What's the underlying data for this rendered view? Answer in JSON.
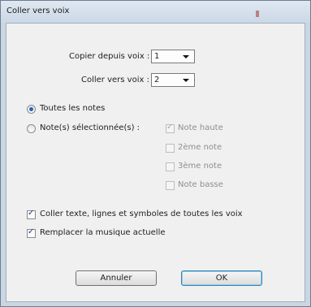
{
  "window": {
    "title": "Coller vers voix"
  },
  "copy_from": {
    "label": "Copier depuis voix :",
    "value": "1"
  },
  "paste_to": {
    "label": "Coller vers voix :",
    "value": "2"
  },
  "scope": {
    "all_notes_label": "Toutes les notes",
    "all_notes_selected": true,
    "selected_notes_label": "Note(s) sélectionnée(s) :",
    "selected_notes_selected": false
  },
  "note_options": [
    {
      "label": "Note haute",
      "checked": true
    },
    {
      "label": "2ème note",
      "checked": false
    },
    {
      "label": "3ème note",
      "checked": false
    },
    {
      "label": "Note basse",
      "checked": false
    }
  ],
  "options": {
    "paste_text_label": "Coller texte, lignes et symboles de toutes les voix",
    "paste_text_checked": true,
    "replace_music_label": "Remplacer la musique actuelle",
    "replace_music_checked": true
  },
  "buttons": {
    "cancel": "Annuler",
    "ok": "OK"
  }
}
